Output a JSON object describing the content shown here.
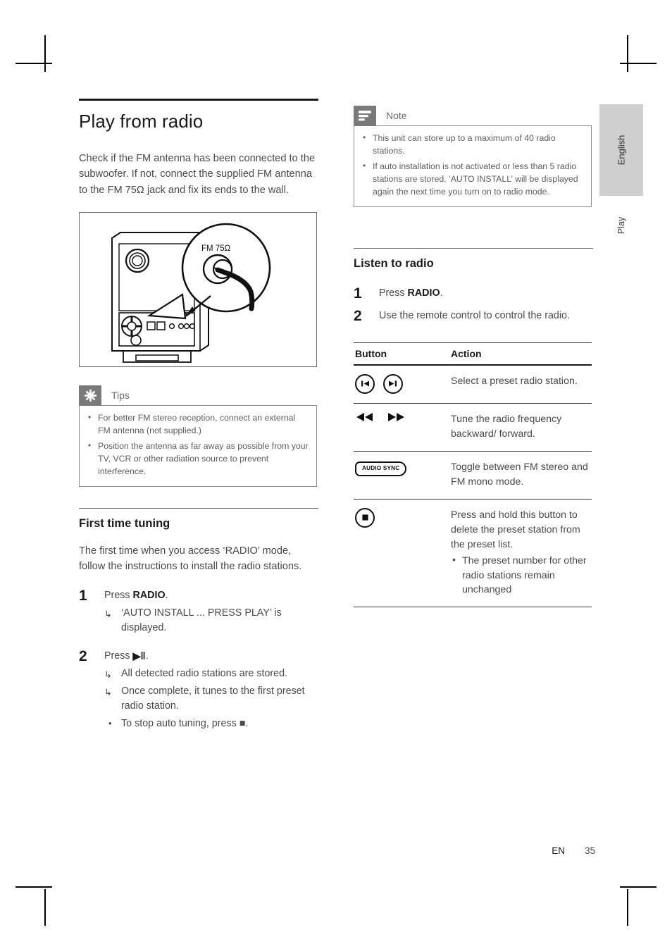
{
  "page": {
    "language_tab": "English",
    "section_tab": "Play",
    "footer_locale": "EN",
    "footer_page_number": "35"
  },
  "left_column": {
    "title": "Play from radio",
    "intro": "Check if the FM antenna has been connected to the subwoofer.  If not, connect the supplied FM antenna to the FM 75Ω jack and fix its ends to the wall.",
    "figure": {
      "name": "subwoofer-fm-antenna-jack-diagram",
      "callout_label": "FM  75Ω"
    },
    "tips": {
      "icon": "asterisk-icon",
      "label": "Tips",
      "items": [
        "For better FM stereo reception, connect an external FM antenna (not supplied.)",
        "Position the antenna as far away as possible from your TV, VCR or other radiation source to prevent interference."
      ]
    },
    "first_time_tuning": {
      "heading": "First time tuning",
      "intro": "The first time when you access ‘RADIO’ mode, follow the instructions to install the radio stations.",
      "steps": [
        {
          "number": "1",
          "text_prefix": "Press ",
          "text_bold": "RADIO",
          "text_suffix": ".",
          "results": [
            {
              "glyph": "arrow",
              "text": "‘AUTO INSTALL ... PRESS PLAY’ is displayed."
            }
          ]
        },
        {
          "number": "2",
          "text_prefix": "Press ",
          "text_bold": "▶‖",
          "text_suffix": ".",
          "results": [
            {
              "glyph": "arrow",
              "text": "All detected radio stations are stored."
            },
            {
              "glyph": "arrow",
              "text": "Once complete, it tunes to the first preset radio station."
            },
            {
              "glyph": "bullet",
              "text": "To stop auto tuning, press ■."
            }
          ]
        }
      ]
    }
  },
  "right_column": {
    "note": {
      "icon": "note-lines-icon",
      "label": "Note",
      "items": [
        "This unit can store up to a maximum of 40 radio stations.",
        "If auto installation is not activated or less than 5 radio stations are stored, ‘AUTO INSTALL’ will be displayed again the next time you turn on to radio mode."
      ]
    },
    "listen_to_radio": {
      "heading": "Listen to radio",
      "steps": [
        {
          "number": "1",
          "text_prefix": "Press ",
          "text_bold": "RADIO",
          "text_suffix": "."
        },
        {
          "number": "2",
          "text_prefix": "Use the remote control to control the radio.",
          "text_bold": "",
          "text_suffix": ""
        }
      ]
    },
    "button_table": {
      "headers": {
        "button": "Button",
        "action": "Action"
      },
      "rows": [
        {
          "button_icons": [
            "previous-track-circle-icon",
            "next-track-circle-icon"
          ],
          "button_text": "",
          "action": "Select a preset radio station.",
          "sub_items": []
        },
        {
          "button_icons": [
            "rewind-icon",
            "fast-forward-icon"
          ],
          "button_text": "",
          "action": "Tune the radio frequency backward/ forward.",
          "sub_items": []
        },
        {
          "button_icons": [
            "audio-sync-button-icon"
          ],
          "button_text": "AUDIO SYNC",
          "action": "Toggle between FM stereo and FM mono mode.",
          "sub_items": []
        },
        {
          "button_icons": [
            "stop-circle-icon"
          ],
          "button_text": "",
          "action": "Press and hold this button to delete the preset station from the preset list.",
          "sub_items": [
            "The preset number for other radio stations remain unchanged"
          ]
        }
      ]
    }
  }
}
